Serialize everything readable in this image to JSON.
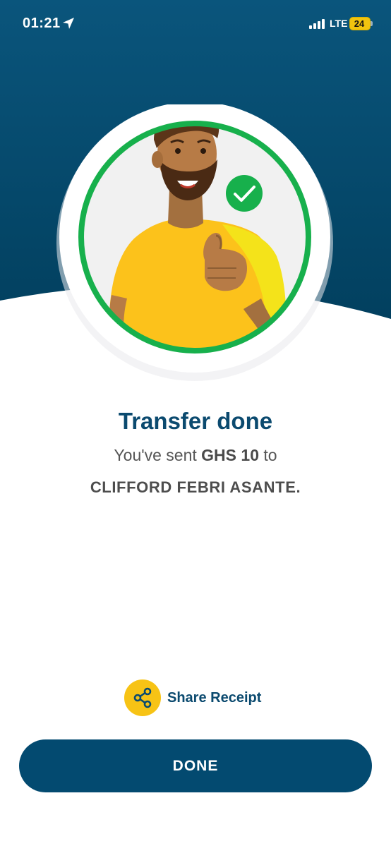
{
  "status_bar": {
    "time": "01:21",
    "network": "LTE",
    "battery_level": "24",
    "icons": [
      "location-arrow-icon",
      "signal-bars-icon",
      "battery-icon"
    ]
  },
  "illustration": {
    "description_icon": "thumbs-up-person-icon",
    "badge_icon": "check-circle-icon"
  },
  "message": {
    "title": "Transfer done",
    "sent_prefix": "You've sent",
    "amount": "GHS 10",
    "sent_suffix": "to",
    "recipient": "CLIFFORD FEBRI ASANTE."
  },
  "actions": {
    "share_label": "Share Receipt",
    "share_icon": "share-icon",
    "done_label": "DONE"
  },
  "colors": {
    "header_bg": "#034a70",
    "brand_blue": "#0b4a6f",
    "accent_yellow": "#f7c315",
    "success_green": "#17b04c"
  }
}
